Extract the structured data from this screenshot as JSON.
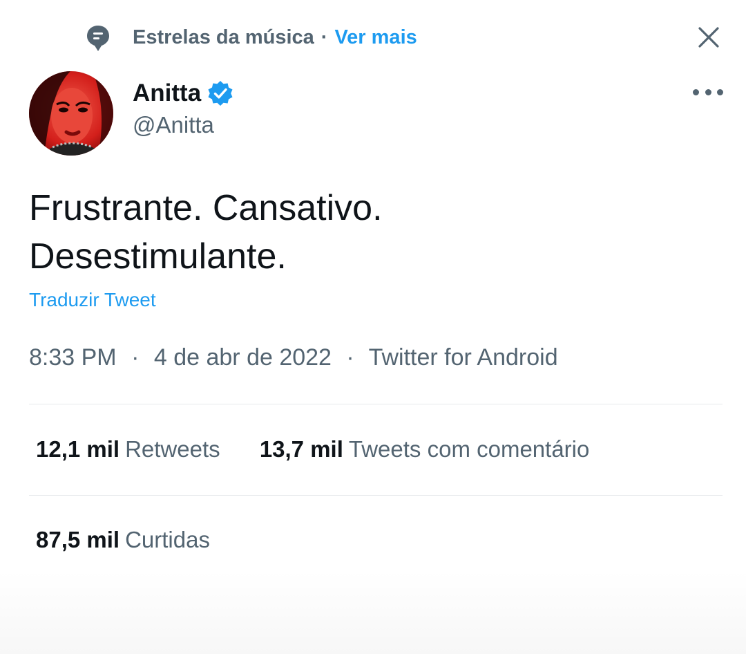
{
  "context": {
    "topic": "Estrelas da música",
    "separator": "·",
    "link": "Ver mais"
  },
  "author": {
    "name": "Anitta",
    "handle": "@Anitta",
    "verified": true
  },
  "tweet": {
    "lines": [
      "Frustrante. Cansativo.",
      "Desestimulante."
    ],
    "translate": "Traduzir Tweet"
  },
  "meta": {
    "time": "8:33 PM",
    "date": "4 de abr de 2022",
    "source": "Twitter for Android",
    "separator": "·"
  },
  "stats": {
    "retweets": {
      "value": "12,1 mil",
      "label": "Retweets"
    },
    "quotes": {
      "value": "13,7 mil",
      "label": "Tweets com comentário"
    },
    "likes": {
      "value": "87,5 mil",
      "label": "Curtidas"
    }
  },
  "icons": {
    "context": "topic-bubble-icon",
    "close": "close-icon",
    "verified": "verified-badge-icon",
    "more": "more-options-icon"
  },
  "colors": {
    "accent": "#1d9bf0",
    "secondary_text": "#536471",
    "primary_text": "#0f1419"
  }
}
